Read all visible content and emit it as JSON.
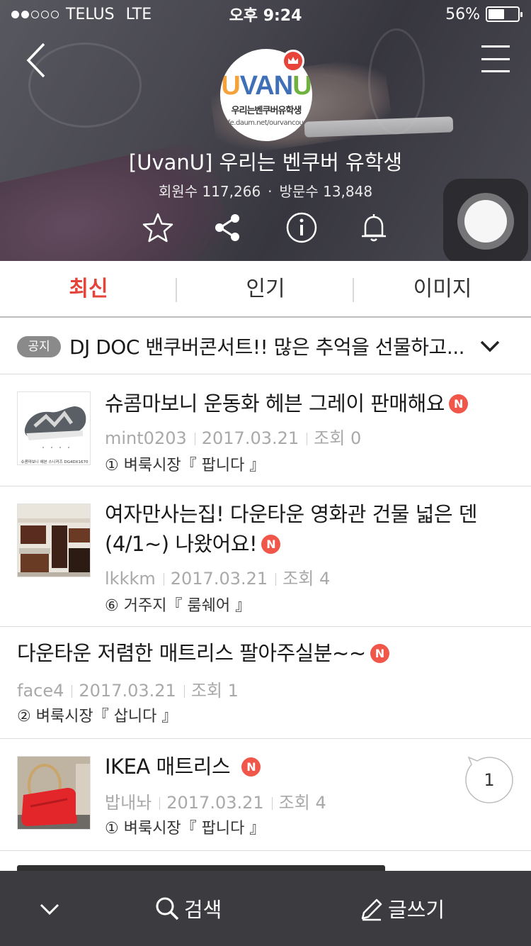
{
  "status_bar": {
    "carrier": "TELUS",
    "network": "LTE",
    "time": "오후 9:24",
    "battery": "56%",
    "battery_level": 0.56,
    "signal_bars": 2
  },
  "cafe": {
    "logo_text": [
      "U",
      "VAN",
      "U"
    ],
    "logo_subtitle": "우리는벤쿠버유학생",
    "logo_url": "cafe.daum.net/ourvancouver",
    "title": "[UvanU] 우리는 벤쿠버 유학생",
    "members": "회원수 117,266",
    "visits": "방문수 13,848",
    "separator": "·"
  },
  "icons": {
    "back": "chevron-left-icon",
    "menu": "hamburger-icon",
    "favorite": "star-icon",
    "share": "share-icon",
    "info": "info-icon",
    "alarm": "bell-icon",
    "assistive": "assistive-touch-icon"
  },
  "tabs": [
    {
      "label": "최신",
      "active": true
    },
    {
      "label": "인기",
      "active": false
    },
    {
      "label": "이미지",
      "active": false
    }
  ],
  "notice": {
    "badge": "공지",
    "text": "DJ DOC 밴쿠버콘서트!! 많은 추억을 선물하고..."
  },
  "posts": [
    {
      "title": "슈콤마보니 운동화 헤븐 그레이 판매해요",
      "is_new": true,
      "new_label": "N",
      "author": "mint0203",
      "date": "2017.03.21",
      "views": "조회 0",
      "board": "① 벼룩시장『 팝니다 』",
      "thumb": "sneaker",
      "thumb_caption": "슈콤마보니 헤븐 스니커즈 DG4DX1670"
    },
    {
      "title": "여자만사는집! 다운타운 영화관 건물 넓은 덴 (4/1~) 나왔어요!",
      "is_new": true,
      "new_label": "N",
      "author": "lkkkm",
      "date": "2017.03.21",
      "views": "조회 4",
      "board": "⑥ 거주지『 룸쉐어 』",
      "thumb": "room"
    },
    {
      "title": "다운타운 저렴한 매트리스 팔아주실분~~",
      "is_new": true,
      "new_label": "N",
      "author": "face4",
      "date": "2017.03.21",
      "views": "조회 1",
      "board": "② 벼룩시장『 삽니다 』",
      "thumb": null
    },
    {
      "title": "IKEA 매트리스",
      "is_new": true,
      "new_label": "N",
      "author": "밥내놔",
      "date": "2017.03.21",
      "views": "조회 4",
      "board": "① 벼룩시장『 팝니다 』",
      "thumb": "mattress",
      "comments": "1"
    }
  ],
  "bottom_bar": {
    "search_label": "검색",
    "write_label": "글쓰기"
  },
  "colors": {
    "accent": "#e4443a",
    "new_badge": "#f0574a",
    "bottom_bar": "#3c3c40"
  }
}
